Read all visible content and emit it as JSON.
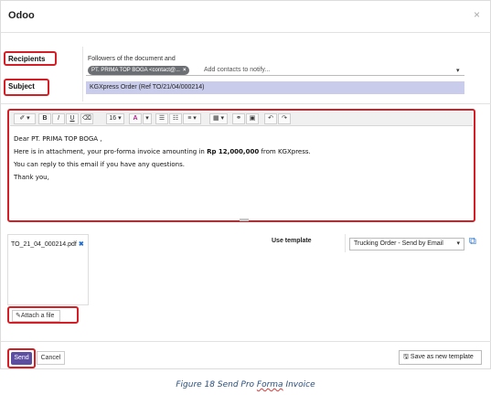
{
  "dialog": {
    "title": "Odoo",
    "close_glyph": "×"
  },
  "fields": {
    "recipients_label": "Recipients",
    "subject_label": "Subject",
    "followers_note": "Followers of the document and",
    "recipient_tag": "PT. PRIMA TOP BOGA <contact@...",
    "recipient_tag_remove": "×",
    "recipients_placeholder": "Add contacts to notify...",
    "subject_value": "KGXpress Order (Ref TO/21/04/000214)"
  },
  "toolbar": {
    "style": "✐ ▾",
    "bold": "B",
    "italic": "I",
    "underline": "U",
    "eraser": "⌫",
    "font_size": "16 ▾",
    "color": "A",
    "color_caret": "▾",
    "ul": "☰",
    "ol": "☷",
    "align": "≡ ▾",
    "table": "▦ ▾",
    "link": "⚭",
    "image": "▣",
    "undo": "↶",
    "redo": "↷"
  },
  "body": {
    "greeting": "Dear PT. PRIMA TOP BOGA ,",
    "line1_pre": "Here is in attachment, your pro-forma invoice amounting in ",
    "line1_amount": "Rp 12,000,000",
    "line1_post": " from KGXpress.",
    "line2": "You can reply to this email if you have any questions.",
    "closing": "Thank you,"
  },
  "attachments": {
    "files": [
      {
        "name": "TO_21_04_000214.pdf",
        "remove_glyph": "✖"
      }
    ],
    "attach_button": "✎Attach a file"
  },
  "template": {
    "label": "Use template",
    "selected": "Trucking Order - Send by Email",
    "caret": "▾",
    "external_link_glyph": "⧉"
  },
  "footer": {
    "send": "Send",
    "cancel": "Cancel",
    "save_template": "🖫 Save as new template"
  },
  "caption": {
    "prefix": "Figure 18 Send Pro ",
    "underlined": "Forma",
    "suffix": " Invoice"
  },
  "colors": {
    "highlight": "#d41f26",
    "send_button": "#5d4ea2",
    "subject_bg": "#c9cdeb",
    "link": "#1f6fd1"
  }
}
